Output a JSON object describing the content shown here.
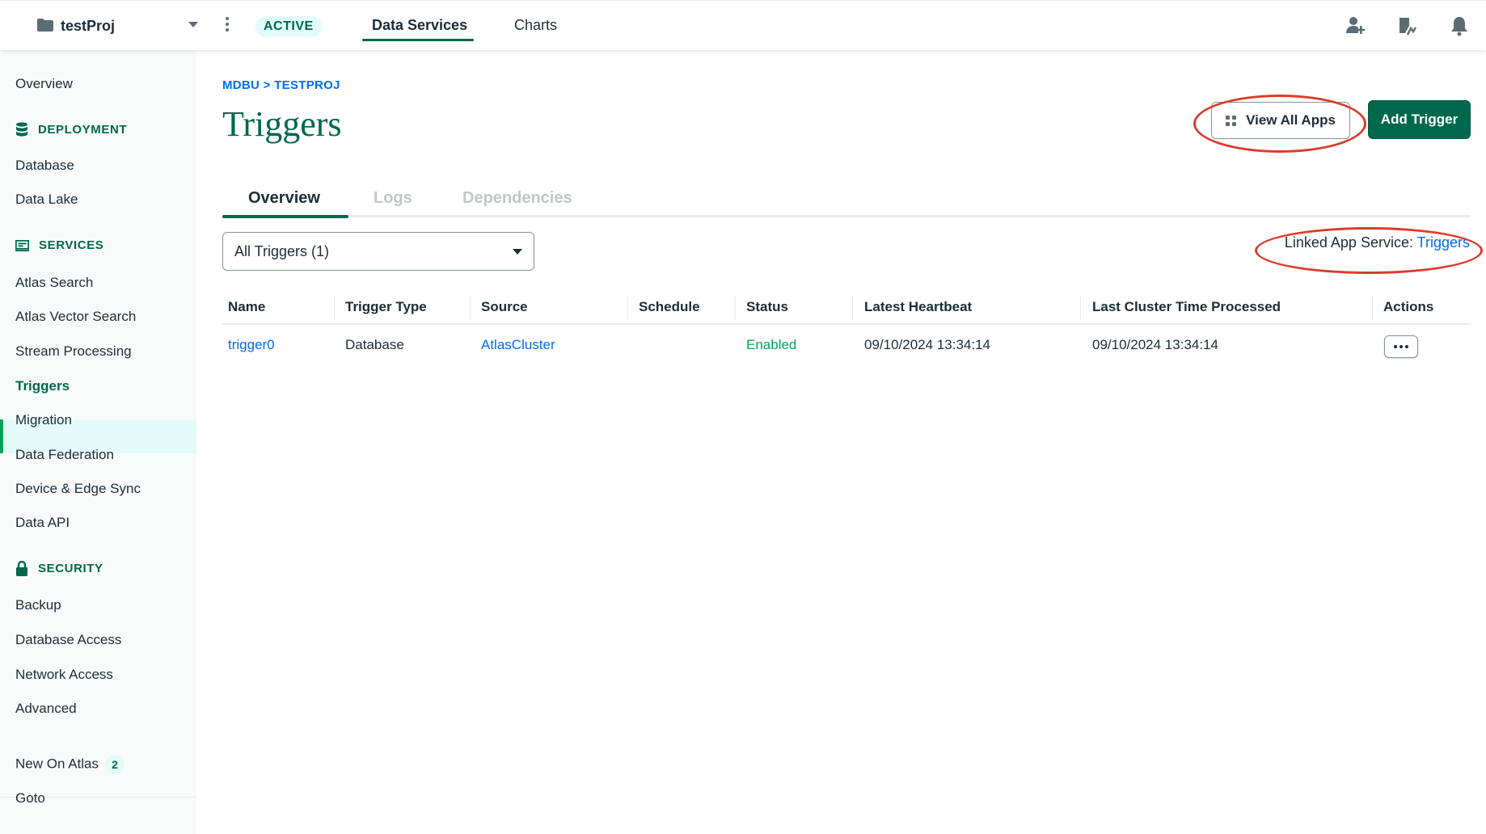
{
  "topbar": {
    "project": "testProj",
    "status": "ACTIVE",
    "tabs": [
      "Data Services",
      "Charts"
    ]
  },
  "sidebar": {
    "overview": "Overview",
    "deployment_heading": "DEPLOYMENT",
    "deployment_items": [
      "Database",
      "Data Lake"
    ],
    "services_heading": "SERVICES",
    "services_items": [
      "Atlas Search",
      "Atlas Vector Search",
      "Stream Processing",
      "Triggers",
      "Migration",
      "Data Federation",
      "Device & Edge Sync",
      "Data API"
    ],
    "security_heading": "SECURITY",
    "security_items": [
      "Backup",
      "Database Access",
      "Network Access",
      "Advanced"
    ],
    "new_on_atlas": "New On Atlas",
    "new_on_atlas_count": "2",
    "goto": "Goto"
  },
  "main": {
    "breadcrumb": "MDBU > TESTPROJ",
    "title": "Triggers",
    "view_all_apps": "View All Apps",
    "add_trigger": "Add Trigger",
    "tabs": [
      "Overview",
      "Logs",
      "Dependencies"
    ],
    "filter_value": "All Triggers (1)",
    "linked_label": "Linked App Service: ",
    "linked_link": "Triggers"
  },
  "table": {
    "headers": [
      "Name",
      "Trigger Type",
      "Source",
      "Schedule",
      "Status",
      "Latest Heartbeat",
      "Last Cluster Time Processed",
      "Actions"
    ],
    "rows": [
      {
        "name": "trigger0",
        "type": "Database",
        "source": "AtlasCluster",
        "schedule": "",
        "status": "Enabled",
        "heartbeat": "09/10/2024 13:34:14",
        "last_cluster_time": "09/10/2024 13:34:14"
      }
    ]
  },
  "colors": {
    "brand_green": "#00684a",
    "link_blue": "#016bf8",
    "annotation_red": "#dc3b2b",
    "enabled_green": "#00a35c"
  }
}
